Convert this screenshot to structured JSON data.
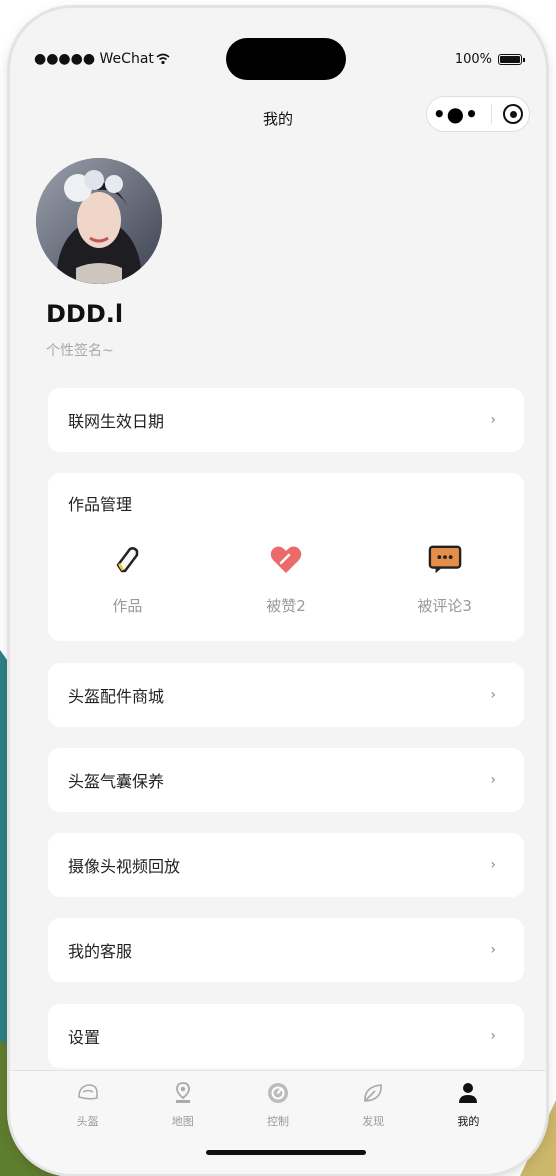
{
  "status_bar": {
    "carrier": "●●●●● WeChat",
    "battery": "100%"
  },
  "nav": {
    "title": "我的"
  },
  "profile": {
    "username": "DDD.l",
    "signature": "个性签名~"
  },
  "menu": {
    "network_date": "联网生效日期",
    "helmet_shop": "头盔配件商城",
    "airbag_care": "头盔气囊保养",
    "camera_replay": "摄像头视频回放",
    "customer_service": "我的客服",
    "settings": "设置",
    "chevron": "›"
  },
  "works": {
    "title": "作品管理",
    "items": [
      {
        "label": "作品",
        "icon": "pencil-icon"
      },
      {
        "label": "被赞2",
        "icon": "heart-icon"
      },
      {
        "label": "被评论3",
        "icon": "comment-icon"
      }
    ]
  },
  "tabs": [
    {
      "label": "头盔",
      "icon": "helmet-icon"
    },
    {
      "label": "地图",
      "icon": "map-pin-icon"
    },
    {
      "label": "控制",
      "icon": "control-dial-icon"
    },
    {
      "label": "发现",
      "icon": "leaf-icon"
    },
    {
      "label": "我的",
      "icon": "person-icon"
    }
  ],
  "colors": {
    "heart": "#ec6a6a",
    "comment": "#e58d4a",
    "background": "#f4f4f4",
    "card": "#ffffff"
  }
}
